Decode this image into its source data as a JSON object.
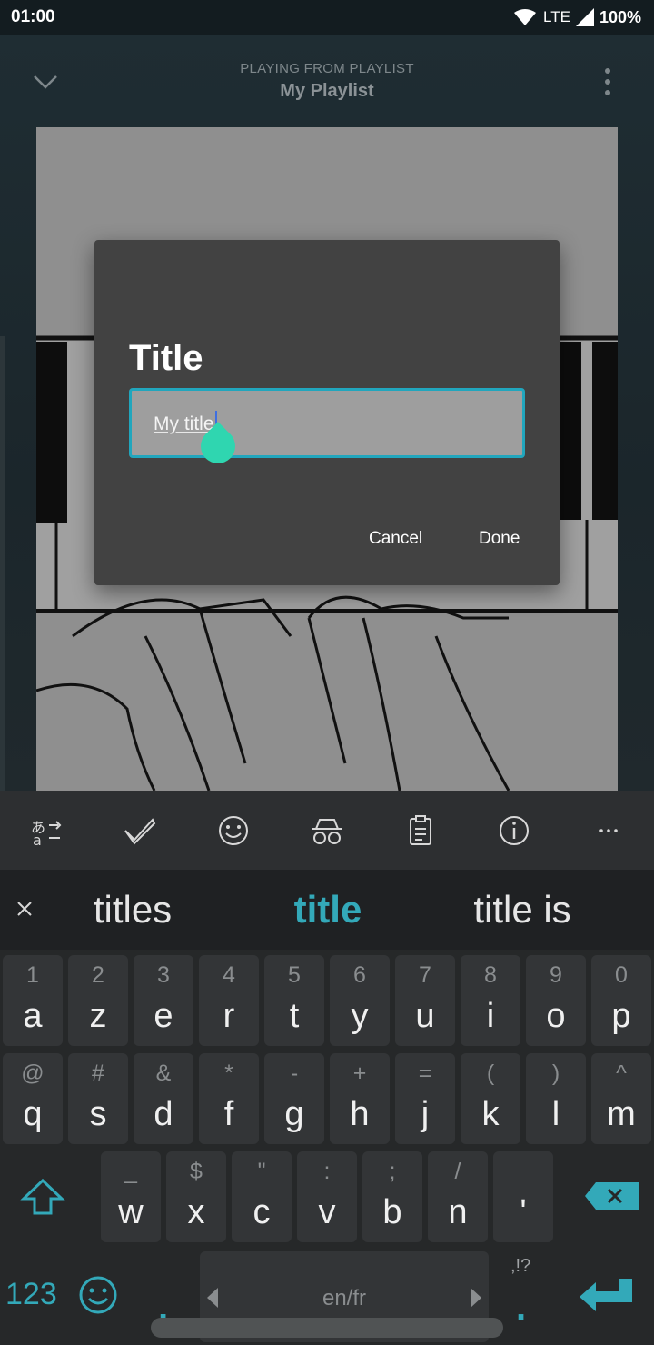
{
  "status": {
    "time": "01:00",
    "network": "LTE",
    "battery": "100%"
  },
  "header": {
    "subtitle": "PLAYING FROM PLAYLIST",
    "title": "My Playlist"
  },
  "dialog": {
    "title": "Title",
    "input_value": "My title",
    "cancel_label": "Cancel",
    "done_label": "Done"
  },
  "toolbar": {
    "icons": [
      "translate-icon",
      "spell-check-icon",
      "emoji-icon",
      "incognito-icon",
      "clipboard-icon",
      "info-icon",
      "more-icon"
    ]
  },
  "suggestions": {
    "left": "titles",
    "middle": "title",
    "right": "title is"
  },
  "keyboard": {
    "row1": [
      {
        "alt": "1",
        "key": "a"
      },
      {
        "alt": "2",
        "key": "z"
      },
      {
        "alt": "3",
        "key": "e"
      },
      {
        "alt": "4",
        "key": "r"
      },
      {
        "alt": "5",
        "key": "t"
      },
      {
        "alt": "6",
        "key": "y"
      },
      {
        "alt": "7",
        "key": "u"
      },
      {
        "alt": "8",
        "key": "i"
      },
      {
        "alt": "9",
        "key": "o"
      },
      {
        "alt": "0",
        "key": "p"
      }
    ],
    "row2": [
      {
        "alt": "@",
        "key": "q"
      },
      {
        "alt": "#",
        "key": "s"
      },
      {
        "alt": "&",
        "key": "d"
      },
      {
        "alt": "*",
        "key": "f"
      },
      {
        "alt": "-",
        "key": "g"
      },
      {
        "alt": "+",
        "key": "h"
      },
      {
        "alt": "=",
        "key": "j"
      },
      {
        "alt": "(",
        "key": "k"
      },
      {
        "alt": ")",
        "key": "l"
      },
      {
        "alt": "^",
        "key": "m"
      }
    ],
    "row3": [
      {
        "alt": "_",
        "key": "w"
      },
      {
        "alt": "$",
        "key": "x"
      },
      {
        "alt": "\"",
        "key": "c"
      },
      {
        "alt": ":",
        "key": "v"
      },
      {
        "alt": ";",
        "key": "b"
      },
      {
        "alt": "/",
        "key": "n"
      },
      {
        "alt": "",
        "key": "'"
      }
    ],
    "numbers_label": "123",
    "space_label": "en/fr",
    "punct_label": ",!?",
    "comma": ",",
    "period": ".",
    "accent_color": "#33a9b9"
  }
}
